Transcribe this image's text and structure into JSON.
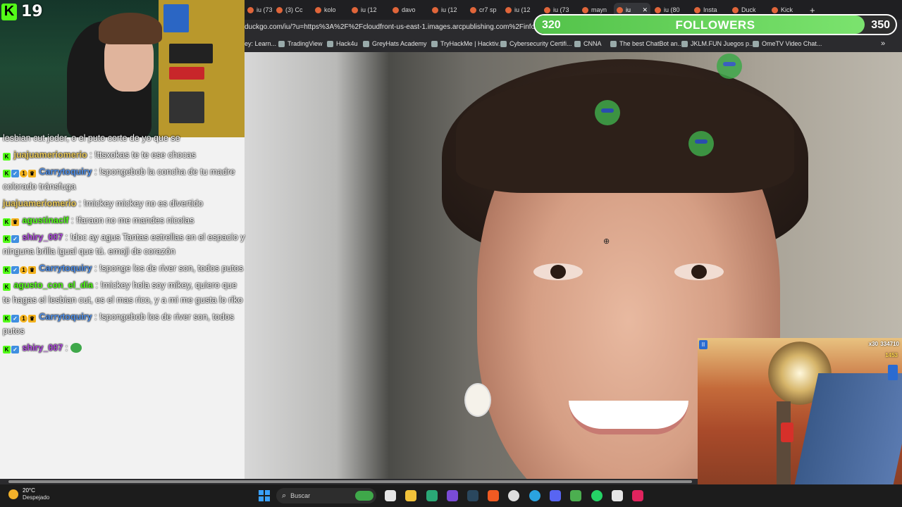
{
  "browser": {
    "tabs": [
      {
        "label": "iu (73"
      },
      {
        "label": "(3) Cc"
      },
      {
        "label": "kolo"
      },
      {
        "label": "iu (12"
      },
      {
        "label": "davo"
      },
      {
        "label": "iu (12"
      },
      {
        "label": "cr7 sp"
      },
      {
        "label": "iu (12"
      },
      {
        "label": "iu (73"
      },
      {
        "label": "mayn"
      },
      {
        "label": "iu",
        "active": true
      },
      {
        "label": "iu (80"
      },
      {
        "label": "Insta"
      },
      {
        "label": "Duck"
      },
      {
        "label": "Kick"
      }
    ],
    "new_tab": "+",
    "url": "duckgo.com/iu/?u=https%3A%2F%2Fcloudfront-us-east-1.images.arcpublishing.com%2Finfobae%2",
    "bookmarks": [
      {
        "label": "ey: Learn..."
      },
      {
        "label": "TradingView"
      },
      {
        "label": "Hack4u"
      },
      {
        "label": "GreyHats Academy"
      },
      {
        "label": "TryHackMe | Hacktiv..."
      },
      {
        "label": "Cybersecurity Certifi..."
      },
      {
        "label": "CNNA"
      },
      {
        "label": "The best ChatBot an..."
      },
      {
        "label": "JKLM.FUN Juegos p..."
      },
      {
        "label": "OmeTV Video Chat..."
      }
    ],
    "bookmarks_more": "»"
  },
  "stream": {
    "viewers": "19",
    "followers": {
      "current": "320",
      "label": "FOLLOWERS",
      "goal": "350",
      "progress": 0.914
    }
  },
  "chat": {
    "partial_line": "lesbian cut joder, o el puto corte de yo que se",
    "messages": [
      {
        "user": "juajuameriomerio",
        "color": "#e8c85a",
        "badges": [
          "kick"
        ],
        "text": "!ttsxokas te te ese chocas"
      },
      {
        "user": "Carrytoquiry",
        "color": "#4f8fe8",
        "badges": [
          "kick",
          "verified",
          "gift",
          "crown"
        ],
        "text": "!spongebob la concha de tu madre colorado tránsfuga"
      },
      {
        "user": "juajuameriomerio",
        "color": "#e8c85a",
        "badges": [],
        "text": "!mickey mickey no es divertido"
      },
      {
        "user": "agustinaclf",
        "color": "#53fc18",
        "badges": [
          "kick",
          "crown"
        ],
        "text": "!faraon no me mandes nicolas"
      },
      {
        "user": "shiry_007",
        "color": "#b04be0",
        "badges": [
          "kick",
          "verified"
        ],
        "text": "!doc ay agus Tantas estrellas en el espacio y ninguna brilla igual que tú. emoji de corazón"
      },
      {
        "user": "Carrytoquiry",
        "color": "#4f8fe8",
        "badges": [
          "kick",
          "verified",
          "gift",
          "crown"
        ],
        "text": "!sponge los de river son, todos putos"
      },
      {
        "user": "agusto_con_el_dia",
        "color": "#53fc18",
        "badges": [
          "kick"
        ],
        "text": "!mickey hola soy mikey, quiero que te hagas el lesbian cut, es el mas rico, y a mi me gusta lo riko"
      },
      {
        "user": "Carrytoquiry",
        "color": "#4f8fe8",
        "badges": [
          "kick",
          "verified",
          "gift",
          "crown"
        ],
        "text": "!spongebob los de river son, todos putos"
      },
      {
        "user": "shiry_007",
        "color": "#b04be0",
        "badges": [
          "kick",
          "verified"
        ],
        "text": "",
        "emote": true
      }
    ]
  },
  "game": {
    "multiplier": "x30",
    "score": "334710",
    "coins": "1453"
  },
  "taskbar": {
    "temperature": "20°C",
    "condition": "Despejado",
    "search_placeholder": "Buscar"
  }
}
